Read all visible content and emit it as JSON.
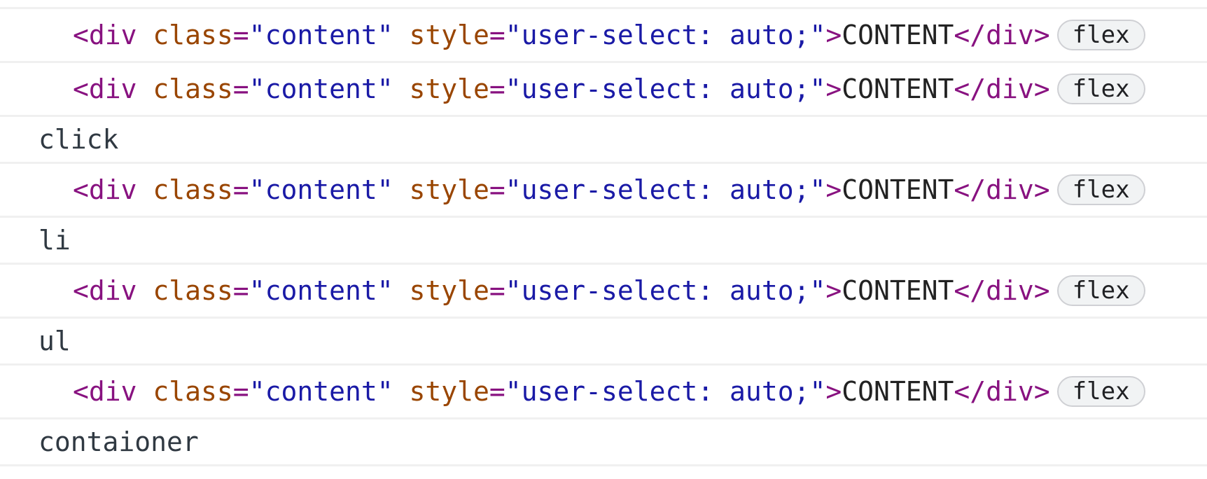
{
  "rows": [
    {
      "type": "tag",
      "tag_open": "<div",
      "attr1_name": " class",
      "eq": "=",
      "attr1_value": "\"content\"",
      "attr2_name": " style",
      "attr2_value": "\"user-select: auto;\"",
      "close": ">",
      "text": "CONTENT",
      "end_tag": "</div>",
      "badge": "flex"
    },
    {
      "type": "tag",
      "tag_open": "<div",
      "attr1_name": " class",
      "eq": "=",
      "attr1_value": "\"content\"",
      "attr2_name": " style",
      "attr2_value": "\"user-select: auto;\"",
      "close": ">",
      "text": "CONTENT",
      "end_tag": "</div>",
      "badge": "flex"
    },
    {
      "type": "text",
      "text": "click"
    },
    {
      "type": "tag",
      "tag_open": "<div",
      "attr1_name": " class",
      "eq": "=",
      "attr1_value": "\"content\"",
      "attr2_name": " style",
      "attr2_value": "\"user-select: auto;\"",
      "close": ">",
      "text": "CONTENT",
      "end_tag": "</div>",
      "badge": "flex"
    },
    {
      "type": "text",
      "text": "li"
    },
    {
      "type": "tag",
      "tag_open": "<div",
      "attr1_name": " class",
      "eq": "=",
      "attr1_value": "\"content\"",
      "attr2_name": " style",
      "attr2_value": "\"user-select: auto;\"",
      "close": ">",
      "text": "CONTENT",
      "end_tag": "</div>",
      "badge": "flex"
    },
    {
      "type": "text",
      "text": "ul"
    },
    {
      "type": "tag",
      "tag_open": "<div",
      "attr1_name": " class",
      "eq": "=",
      "attr1_value": "\"content\"",
      "attr2_name": " style",
      "attr2_value": "\"user-select: auto;\"",
      "close": ">",
      "text": "CONTENT",
      "end_tag": "</div>",
      "badge": "flex"
    },
    {
      "type": "text",
      "text": "contaioner"
    }
  ]
}
